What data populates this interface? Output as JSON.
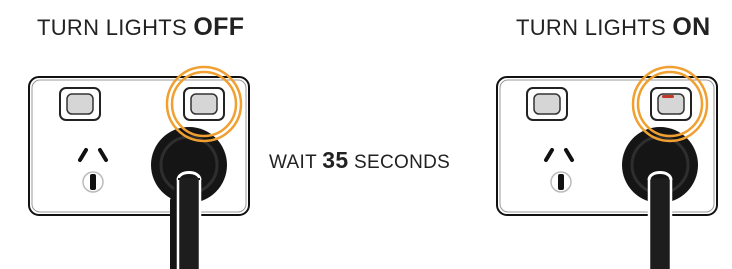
{
  "steps": [
    {
      "prefix": "TURN LIGHTS",
      "state": "OFF"
    },
    {
      "prefix": "TURN LIGHTS",
      "state": "ON"
    }
  ],
  "wait": {
    "prefix": "WAIT",
    "seconds": "35",
    "suffix": "SECONDS"
  },
  "colors": {
    "highlight_ring": "#F0A030",
    "indicator_light": "#C0392B",
    "outline": "#111111",
    "plug": "#151515"
  },
  "icons": {
    "outlet": "power-outlet-icon",
    "plug": "plug-icon",
    "switch": "switch-icon",
    "highlight": "highlight-ring-icon",
    "indicator": "indicator-light-icon"
  }
}
